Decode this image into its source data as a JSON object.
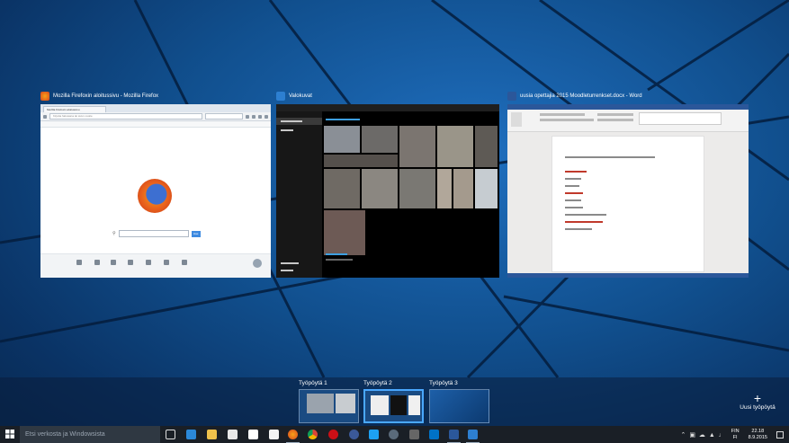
{
  "windows": [
    {
      "title": "Mozilla Firefoxin aloitussivu - Mozilla Firefox",
      "icon": "firefox-icon"
    },
    {
      "title": "Valokuvat",
      "icon": "photos-icon"
    },
    {
      "title": "uusia opettajia 2015 Moodleturrenkset.docx - Word",
      "icon": "word-icon"
    }
  ],
  "firefox": {
    "tab_label": "Mozilla Firefoxin aloitussivu",
    "url_placeholder": "Kirjoita hakusana tai sivun osoite",
    "search_button": "Hae"
  },
  "desktops": [
    {
      "label": "Työpöytä 1"
    },
    {
      "label": "Työpöytä 2",
      "active": true
    },
    {
      "label": "Työpöytä 3"
    }
  ],
  "new_desktop": "Uusi työpöytä",
  "taskbar": {
    "search_placeholder": "Etsi verkosta ja Windowsista",
    "lang_top": "FIN",
    "lang_bottom": "FI",
    "time": "22.18",
    "date": "8.9.2015"
  },
  "colors": {
    "accent": "#4aa8ff",
    "word_blue": "#2b579a",
    "taskbar_bg": "#1a1f26"
  }
}
